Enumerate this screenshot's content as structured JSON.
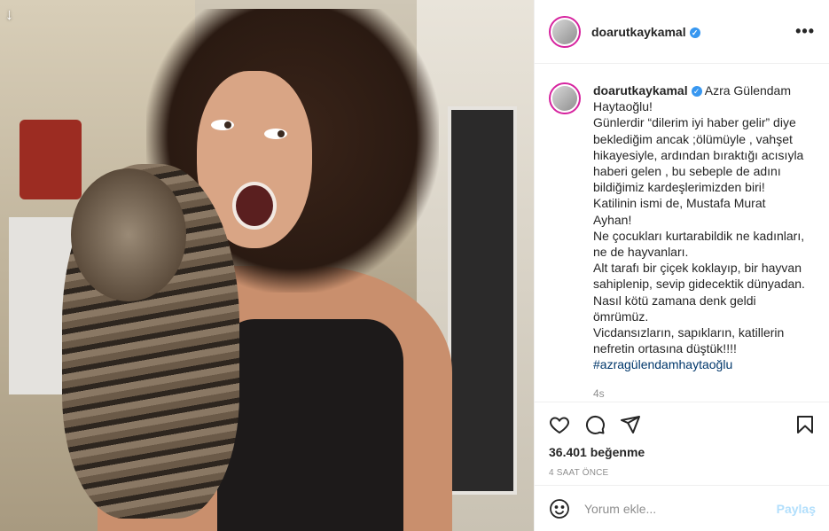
{
  "post": {
    "download_icon": "arrow-down-icon"
  },
  "header": {
    "username": "doarutkaykamal",
    "more_icon": "more-horizontal-icon",
    "more_label": "•••"
  },
  "caption": {
    "username": "doarutkaykamal",
    "lines": [
      "Azra Gülendam",
      "Haytaoğlu!",
      "Günlerdir “dilerim iyi haber gelir” diye",
      "beklediğim ancak ;ölümüyle , vahşet",
      "hikayesiyle, ardından bıraktığı acısıyla",
      "haberi gelen , bu sebeple de adını",
      "bildiğimiz kardeşlerimizden biri!",
      "Katilinin ismi de, Mustafa Murat",
      "Ayhan!",
      "Ne çocukları kurtarabildik ne kadınları,",
      "ne de hayvanları.",
      "Alt tarafı bir çiçek koklayıp, bir hayvan",
      "sahiplenip, sevip gidecektik dünyadan.",
      "Nasıl kötü zamana denk geldi",
      "ömrümüz.",
      "Vicdansızların, sapıkların, katillerin",
      "nefretin ortasına düştük!!!!"
    ],
    "hashtag": "#azragülendamhaytaoğlu",
    "time": "4s"
  },
  "actions": {
    "likes": "36.401 beğenme",
    "ago": "4 SAAT ÖNCE"
  },
  "comment_box": {
    "placeholder": "Yorum ekle...",
    "post_label": "Paylaş"
  },
  "colors": {
    "verified": "#3897f0",
    "post_disabled": "#b2dffc",
    "hashtag": "#00376b"
  }
}
